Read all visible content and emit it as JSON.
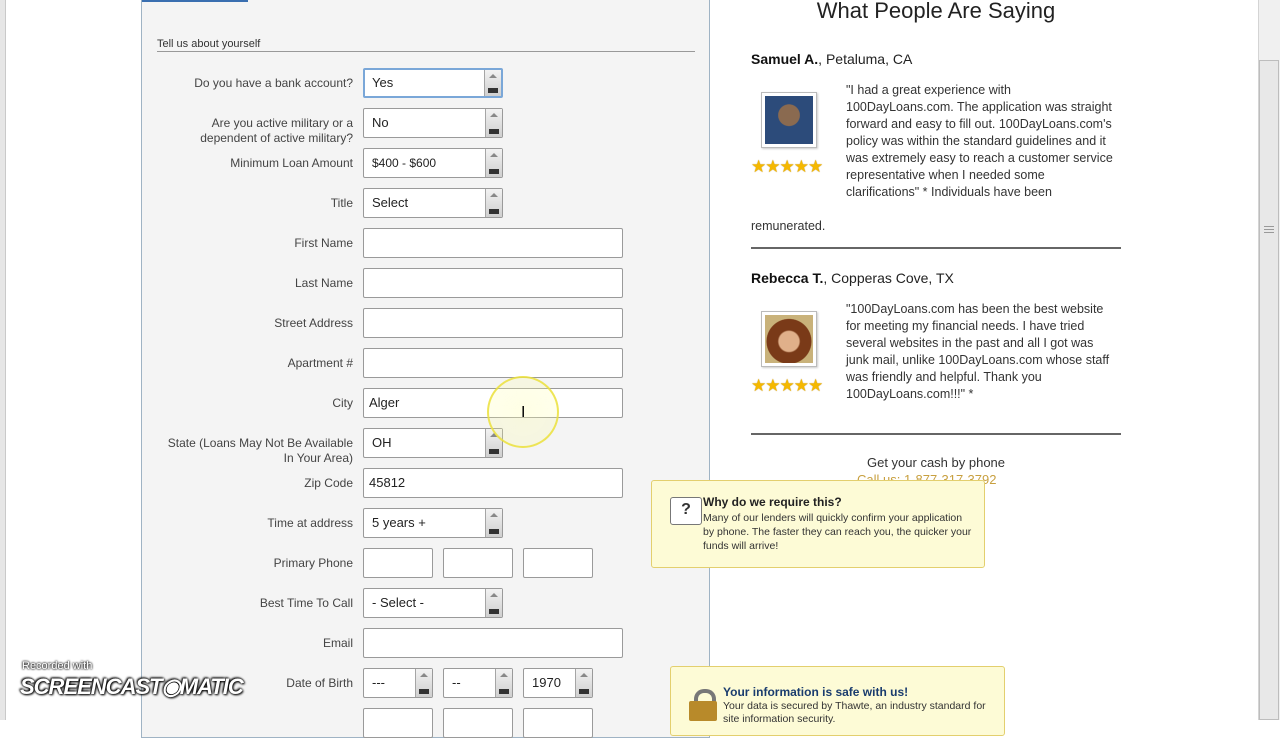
{
  "form": {
    "section_title": "Tell us about yourself",
    "fields": {
      "bank_account": {
        "label": "Do you have a bank account?",
        "value": "Yes"
      },
      "military": {
        "label_line1": "Are you active military or a",
        "label_line2": "dependent of active military?",
        "value": "No"
      },
      "min_loan": {
        "label": "Minimum Loan Amount",
        "value": "$400 - $600"
      },
      "title": {
        "label": "Title",
        "value": "Select"
      },
      "first_name": {
        "label": "First Name",
        "value": ""
      },
      "last_name": {
        "label": "Last Name",
        "value": ""
      },
      "street": {
        "label": "Street Address",
        "value": ""
      },
      "apartment": {
        "label": "Apartment #",
        "value": ""
      },
      "city": {
        "label": "City",
        "value": "Alger"
      },
      "state": {
        "label_line1": "State (Loans May Not Be Available",
        "label_line2": "In Your Area)",
        "value": "OH"
      },
      "zip": {
        "label": "Zip Code",
        "value": "45812"
      },
      "time_at_address": {
        "label": "Time at address",
        "value": "5 years +"
      },
      "primary_phone": {
        "label": "Primary Phone"
      },
      "best_time": {
        "label": "Best Time To Call",
        "value": "- Select -"
      },
      "email": {
        "label": "Email",
        "value": ""
      },
      "dob": {
        "label": "Date of Birth",
        "month": "---",
        "day": "--",
        "year": "1970"
      }
    }
  },
  "testimonials": {
    "heading": "What People Are Saying",
    "rating_stars": "★★★★★",
    "items": [
      {
        "name": "Samuel A.",
        "location": ", Petaluma, CA",
        "quote": "\"I had a great experience with 100DayLoans.com. The application was straight forward and easy to fill out. 100DayLoans.com's policy was within the standard guidelines and it was extremely easy to reach a customer service representative when I needed some clarifications\" * Individuals have been",
        "quote_tail": "remunerated."
      },
      {
        "name": "Rebecca T.",
        "location": ", Copperas Cove, TX",
        "quote": "\"100DayLoans.com has been the best website for meeting my financial needs. I have tried several websites in the past and all I got was junk mail, unlike 100DayLoans.com whose staff was friendly and helpful. Thank you 100DayLoans.com!!!\" *"
      }
    ]
  },
  "phone_cta": {
    "text": "Get your cash by phone",
    "number": "Call us: 1-877-317-3792"
  },
  "tooltip": {
    "icon": "?",
    "title": "Why do we require this?",
    "body": "Many of our lenders will quickly confirm your application by phone. The faster they can reach you, the quicker your funds will arrive!"
  },
  "security": {
    "title": "Your information is safe with us!",
    "body": "Your data is secured by Thawte, an industry standard for site information security."
  },
  "watermark": {
    "line1": "Recorded with",
    "line2": "SCREENCAST◉MATIC"
  },
  "colors": {
    "accent": "#3a6fb0",
    "tooltip_bg": "#fdfbd6",
    "star": "#f5b800",
    "phone": "#c8a040"
  }
}
